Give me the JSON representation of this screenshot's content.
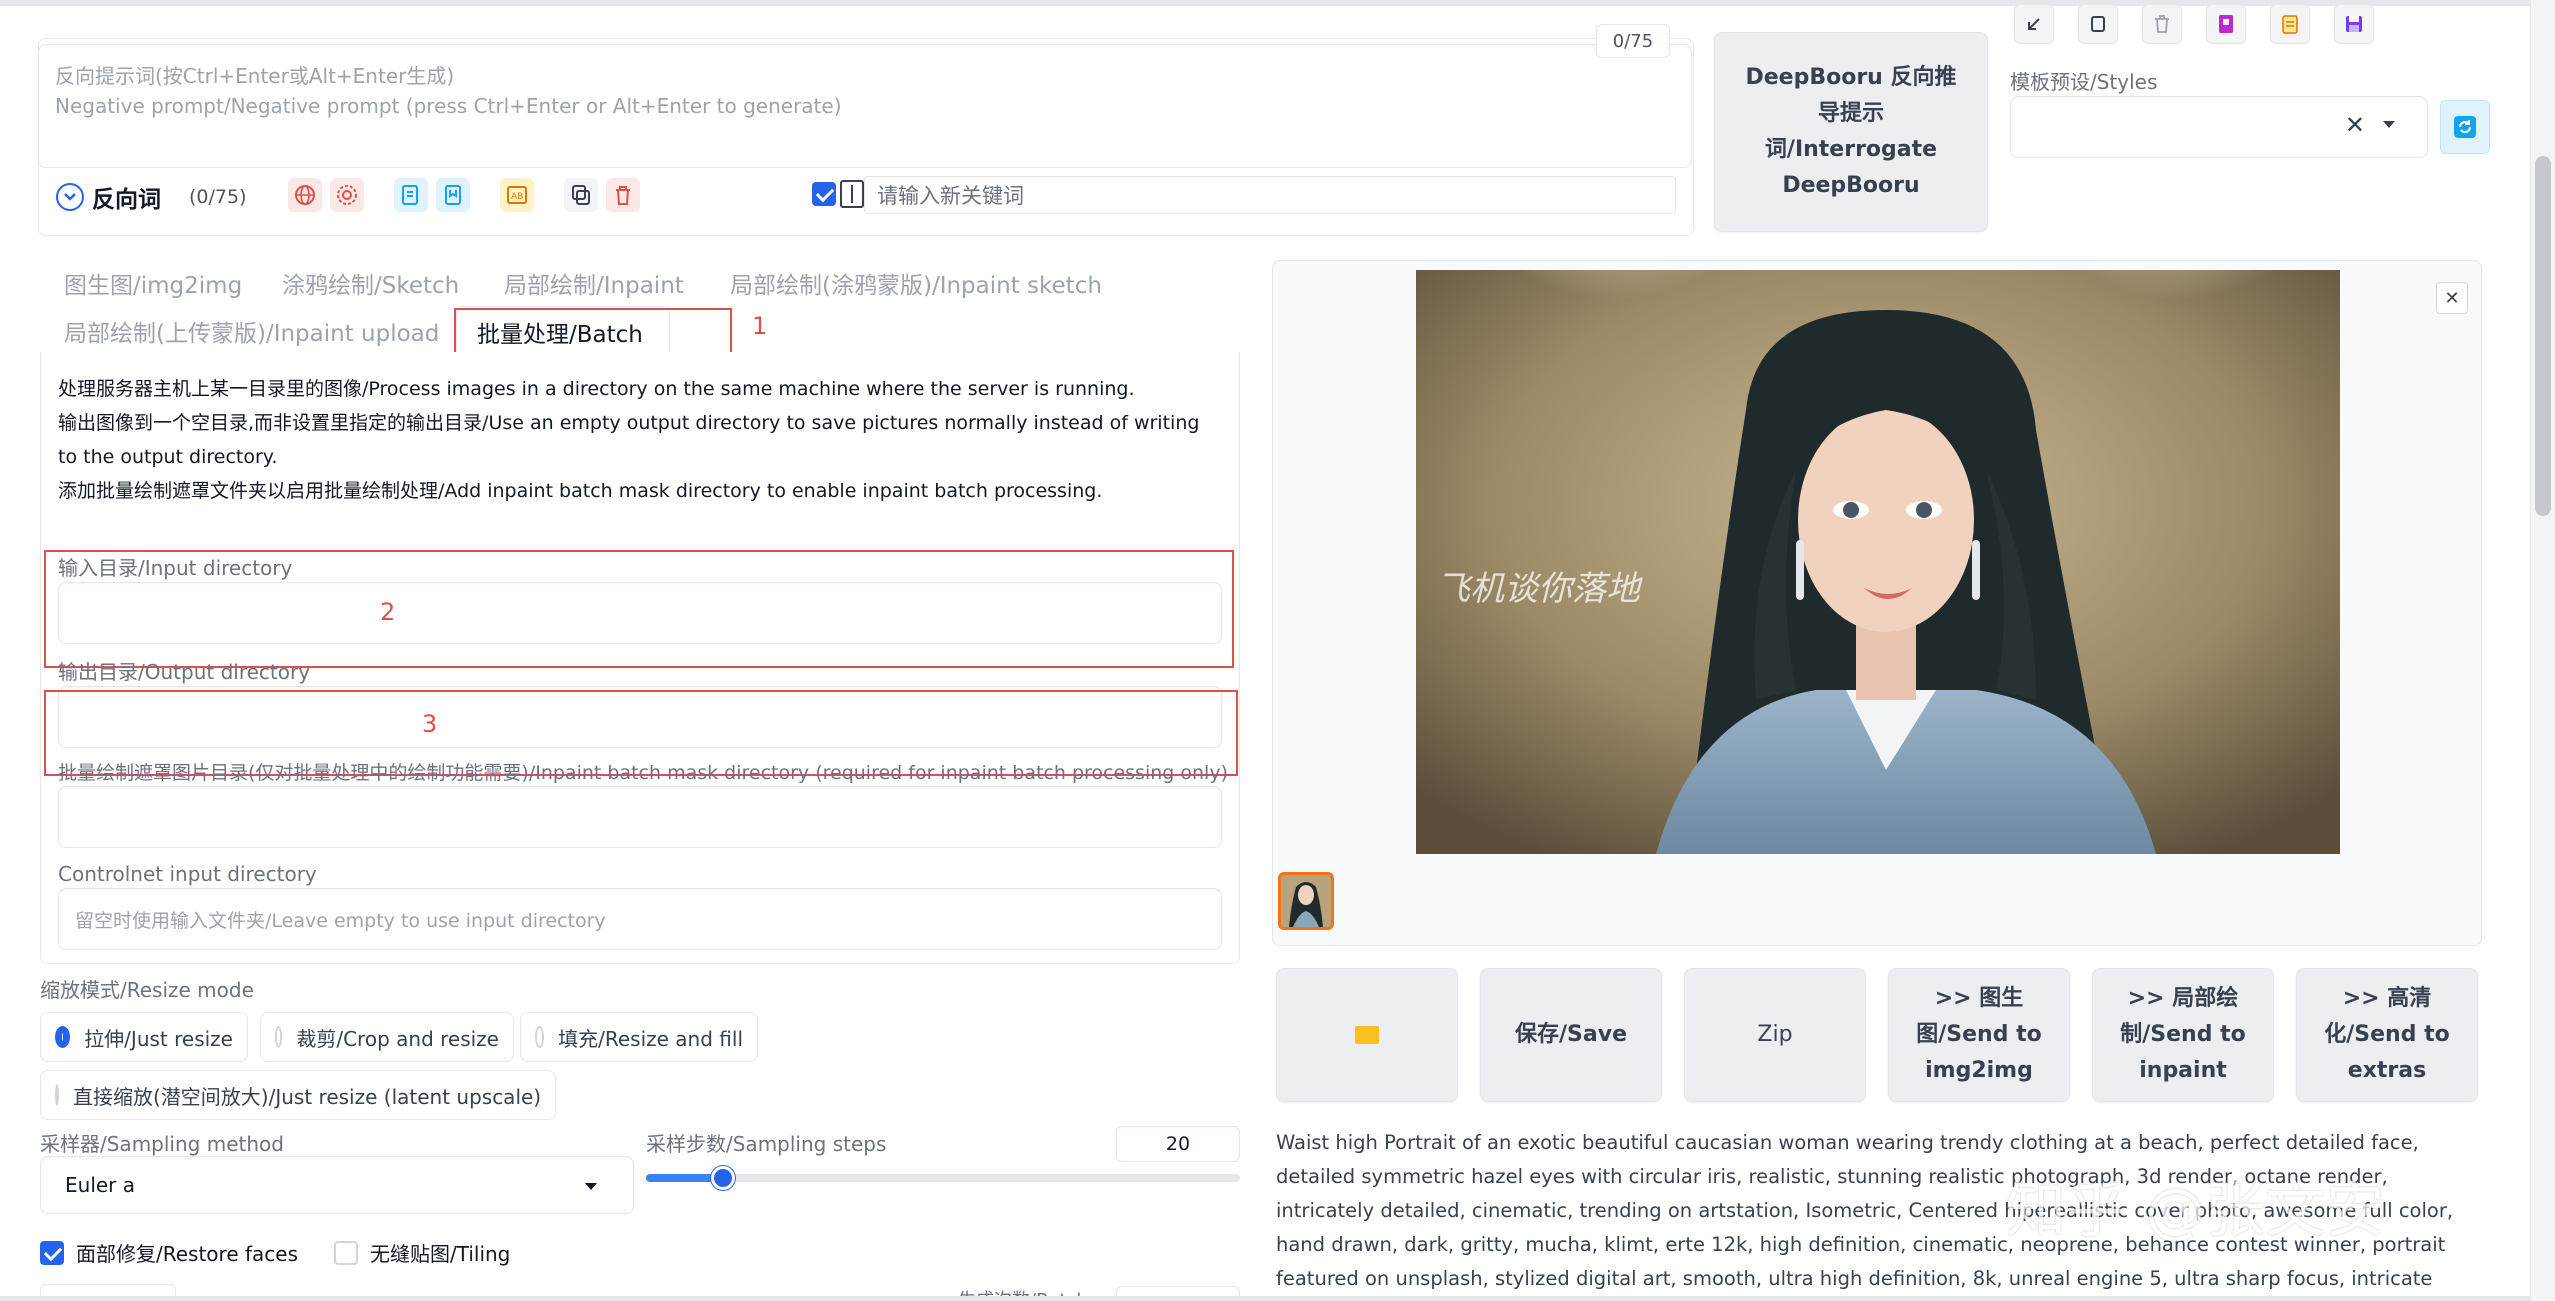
{
  "neg_prompt": {
    "placeholder_line1": "反向提示词(按Ctrl+Enter或Alt+Enter生成)",
    "placeholder_line2": "Negative prompt/Negative prompt (press Ctrl+Enter or Alt+Enter to generate)",
    "token_count": "0/75"
  },
  "neg_toolbar": {
    "label": "反向词",
    "count": "(0/75)",
    "keyword_placeholder": "请输入新关键词"
  },
  "interrogate_button": "DeepBooru 反向推导提示词/Interrogate DeepBooru",
  "styles": {
    "label": "模板预设/Styles"
  },
  "tabs": [
    {
      "label": "图生图/img2img"
    },
    {
      "label": "涂鸦绘制/Sketch"
    },
    {
      "label": "局部绘制/Inpaint"
    },
    {
      "label": "局部绘制(涂鸦蒙版)/Inpaint sketch"
    },
    {
      "label": "局部绘制(上传蒙版)/Inpaint upload"
    },
    {
      "label": "批量处理/Batch"
    }
  ],
  "annotations": {
    "n1": "1",
    "n2": "2",
    "n3": "3"
  },
  "batch": {
    "desc1": "处理服务器主机上某一目录里的图像/Process images in a directory on the same machine where the server is running.",
    "desc2": "输出图像到一个空目录,而非设置里指定的输出目录/Use an empty output directory to save pictures normally instead of writing to the output directory.",
    "desc3": "添加批量绘制遮罩文件夹以启用批量绘制处理/Add inpaint batch mask directory to enable inpaint batch processing.",
    "input_dir_label": "输入目录/Input directory",
    "output_dir_label": "输出目录/Output directory",
    "mask_dir_label": "批量绘制遮罩图片目录(仅对批量处理中的绘制功能需要)/Inpaint batch mask directory (required for inpaint batch processing only)",
    "controlnet_label": "Controlnet input directory",
    "controlnet_placeholder": "留空时使用输入文件夹/Leave empty to use input directory"
  },
  "resize": {
    "label": "缩放模式/Resize mode",
    "options": [
      "拉伸/Just resize",
      "裁剪/Crop and resize",
      "填充/Resize and fill",
      "直接缩放(潜空间放大)/Just resize (latent upscale)"
    ],
    "selected": 0
  },
  "sampler": {
    "label": "采样器/Sampling method",
    "value": "Euler a"
  },
  "steps": {
    "label": "采样步数/Sampling steps",
    "value": "20",
    "fraction": 0.13
  },
  "checks": {
    "restore_faces": "面部修复/Restore faces",
    "tiling": "无缝贴图/Tiling"
  },
  "bottom_cut": {
    "batch_count": "生成次数/Batch"
  },
  "output_buttons": [
    {
      "label": "📁"
    },
    {
      "label": "保存/Save"
    },
    {
      "label": "Zip"
    },
    {
      "label": ">> 图生图/Send to img2img"
    },
    {
      "label": ">> 局部绘制/Send to inpaint"
    },
    {
      "label": ">> 高清化/Send to extras"
    }
  ],
  "image": {
    "overlay_text": "飞机谈你落地"
  },
  "info_text": "Waist high Portrait of an exotic beautiful caucasian woman wearing trendy clothing at a beach, perfect detailed face, detailed symmetric hazel eyes with circular iris, realistic, stunning realistic photograph, 3d render, octane render, intricately detailed, cinematic, trending on artstation, Isometric, Centered hipereallistic cover photo, awesome full color, hand drawn, dark, gritty, mucha, klimt, erte 12k, high definition, cinematic, neoprene, behance contest winner, portrait featured on unsplash, stylized digital art, smooth, ultra high definition, 8k, unreal engine 5, ultra sharp focus, intricate artwork masterpiece, ominous, epic, TanvirTamim, trending on artstation, by artgerm, h. r.",
  "watermark": "知乎 @张文安",
  "colors": {
    "accent": "#2563eb",
    "annotation": "#e0504a",
    "thumb_border": "#f97316"
  }
}
